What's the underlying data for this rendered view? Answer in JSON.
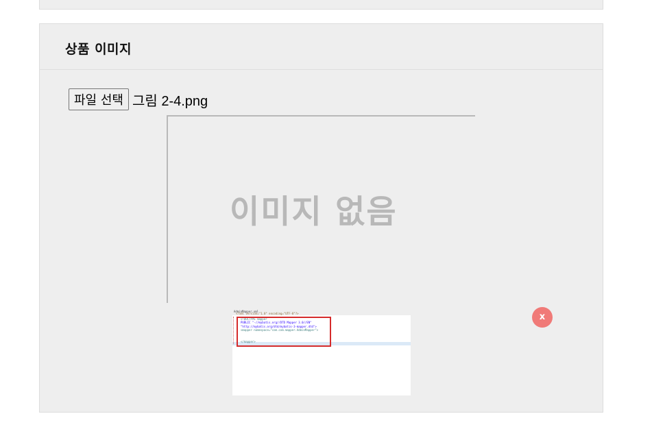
{
  "section_title": "상품 이미지",
  "file_input": {
    "button_label": "파일 선택",
    "file_name": "그림 2-4.png"
  },
  "preview": {
    "placeholder_text": "이미지 없음"
  },
  "thumbnail": {
    "tab_label": "AdminMapper.xml",
    "code_lines": [
      "<?xml version=\"1.0\" encoding=\"UTF-8\"?>",
      "<!DOCTYPE mapper",
      "  PUBLIC \"-//mybatis.org//DTD Mapper 3.0//EN\"",
      "  \"http://mybatis.org/dtd/mybatis-3-mapper.dtd\">",
      "<mapper namespace=\"com.com.mapper.AdminMapper\">",
      "",
      "",
      "</mapper>"
    ]
  },
  "remove_button": {
    "label": "x"
  },
  "colors": {
    "panel_bg": "#eeeeee",
    "placeholder_text": "#b8b8b8",
    "remove_button_bg": "#f07a78",
    "highlight_box": "#d52b2b"
  }
}
